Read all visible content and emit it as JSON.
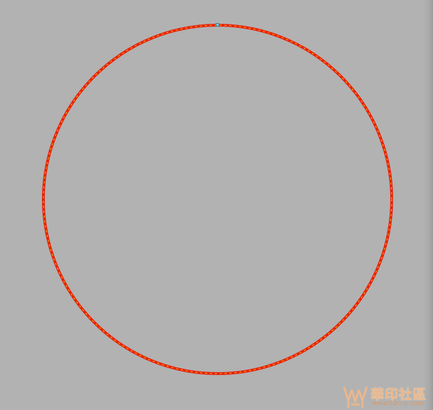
{
  "canvas": {
    "background_color": "#b2b2b2"
  },
  "shape": {
    "kind": "circle",
    "stroke_color": "#e8200a",
    "dash_color": "#f2c200",
    "selection_handle_icon": "node-handle-icon",
    "handle_color": "#7fd0e0"
  },
  "watermark": {
    "title": "華印社區",
    "url": "www.52cnp.com",
    "logo_icon": "hua-yin-logo-icon",
    "color": "#e9b78c"
  }
}
